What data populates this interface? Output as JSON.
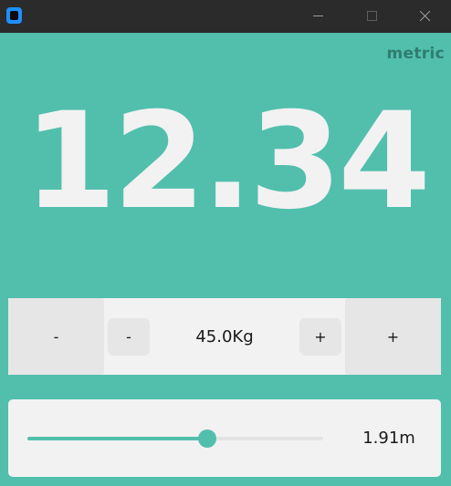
{
  "colors": {
    "background": "#52bfad",
    "titlebar": "#2b2b2b",
    "panel": "#f2f2f2",
    "button": "#e6e6e6",
    "accent": "#52bfad",
    "mode_label": "#2f7d6f",
    "bmi_text": "#f2f2f2"
  },
  "titlebar": {
    "icons": {
      "app": "app-icon",
      "minimize": "minimize-icon",
      "maximize": "maximize-icon",
      "close": "close-icon"
    }
  },
  "mode": {
    "label": "metric"
  },
  "bmi": {
    "value": "12.34"
  },
  "weight": {
    "decrease_large_label": "-",
    "decrease_small_label": "-",
    "value": "45.0Kg",
    "increase_small_label": "+",
    "increase_large_label": "+"
  },
  "height": {
    "value": "1.91m",
    "slider_fraction": 0.608
  }
}
